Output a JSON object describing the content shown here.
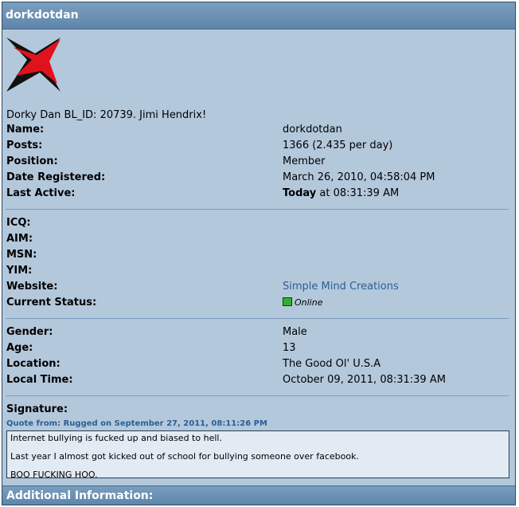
{
  "header": {
    "title": "dorkdotdan"
  },
  "profile": {
    "bio": "Dorky Dan BL_ID: 20739. Jimi Hendrix!",
    "name_label": "Name:",
    "name_value": "dorkdotdan",
    "posts_label": "Posts:",
    "posts_value": "1366 (2.435 per day)",
    "position_label": "Position:",
    "position_value": "Member",
    "registered_label": "Date Registered:",
    "registered_value": "March 26, 2010, 04:58:04 PM",
    "active_label": "Last Active:",
    "active_today": "Today",
    "active_time": " at 08:31:39 AM"
  },
  "contact": {
    "icq_label": "ICQ:",
    "aim_label": "AIM:",
    "msn_label": "MSN:",
    "yim_label": "YIM:",
    "website_label": "Website:",
    "website_value": "Simple Mind Creations",
    "status_label": "Current Status:",
    "status_value": "Online"
  },
  "personal": {
    "gender_label": "Gender:",
    "gender_value": "Male",
    "age_label": "Age:",
    "age_value": "13",
    "location_label": "Location:",
    "location_value": "The Good Ol' U.S.A",
    "localtime_label": "Local Time:",
    "localtime_value": "October 09, 2011, 08:31:39 AM"
  },
  "signature": {
    "label": "Signature:",
    "quote_header": "Quote from: Rugged on September 27, 2011, 08:11:26 PM",
    "line1": "Internet bullying is fucked up and biased to hell.",
    "line2": "Last year I almost got kicked out of school for bullying someone over facebook.",
    "line3": "BOO FUCKING HOO."
  },
  "footer": {
    "title": "Additional Information:"
  },
  "colors": {
    "panel": "#b4c8dc",
    "header": "#6a90b4",
    "link": "#2a5f94",
    "star_red": "#e0121e",
    "star_black": "#111111"
  }
}
